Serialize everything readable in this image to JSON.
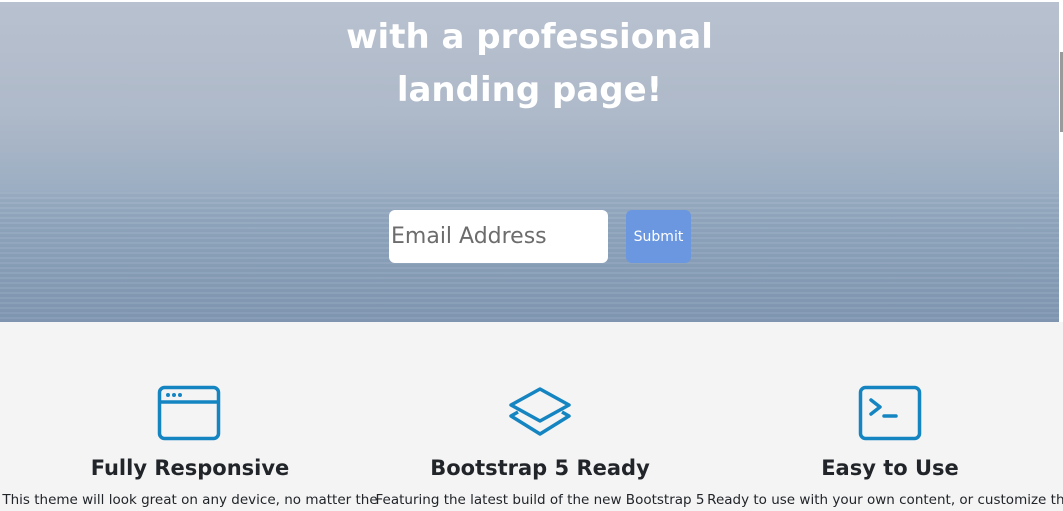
{
  "hero": {
    "title_line_1": "with a professional",
    "title_line_2": "landing page!"
  },
  "signup": {
    "email_placeholder": "Email Address",
    "submit_label": "Submit"
  },
  "features": [
    {
      "icon": "browser-window-icon",
      "title": "Fully Responsive",
      "text": "This theme will look great on any device, no matter the"
    },
    {
      "icon": "layers-icon",
      "title": "Bootstrap 5 Ready",
      "text": "Featuring the latest build of the new Bootstrap 5"
    },
    {
      "icon": "terminal-icon",
      "title": "Easy to Use",
      "text": "Ready to use with your own content, or customize the"
    }
  ],
  "colors": {
    "accent_blue": "#1585c2",
    "submit_button": "#6a97e0",
    "features_background": "#f4f4f4"
  }
}
